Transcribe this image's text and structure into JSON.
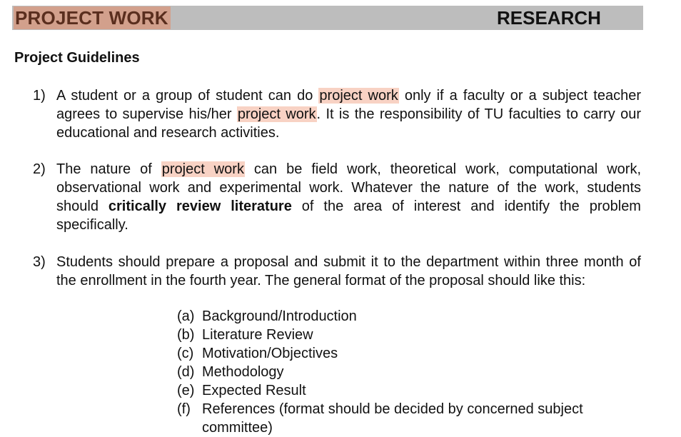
{
  "header": {
    "left_title": "PROJECT WORK",
    "right_title": "RESEARCH"
  },
  "section_title": "Project Guidelines",
  "items": [
    {
      "num": "1)",
      "t1": "A student or a group of student can do ",
      "h1": "project work",
      "t2": " only if a faculty or a subject teacher agrees to supervise his/her ",
      "h2": "project work",
      "t3": ". It is the responsibility of TU faculties to carry our educational and research activities."
    },
    {
      "num": "2)",
      "t1": "The nature of ",
      "h1": "project work",
      "t2": " can be field work, theoretical work, computational work, observational work and experimental work. Whatever the nature of the work, students should ",
      "b1": "critically review literature",
      "t3": " of the area of interest and identify the problem specifically."
    },
    {
      "num": "3)",
      "t1": "Students should prepare a proposal and submit it to the department within three month of the enrollment in the fourth year. The general format of the proposal should like this:"
    }
  ],
  "proposal_format": [
    {
      "label": "(a)",
      "text": "Background/Introduction"
    },
    {
      "label": "(b)",
      "text": "Literature Review"
    },
    {
      "label": "(c)",
      "text": "Motivation/Objectives"
    },
    {
      "label": "(d)",
      "text": "Methodology"
    },
    {
      "label": "(e)",
      "text": "Expected Result"
    },
    {
      "label": "(f)",
      "text": "References (format should be decided by concerned subject committee)"
    }
  ],
  "colors": {
    "header_bar": "#bdbdbd",
    "title_highlight": "#d2a08c",
    "search_highlight": "#f8d2c4"
  }
}
